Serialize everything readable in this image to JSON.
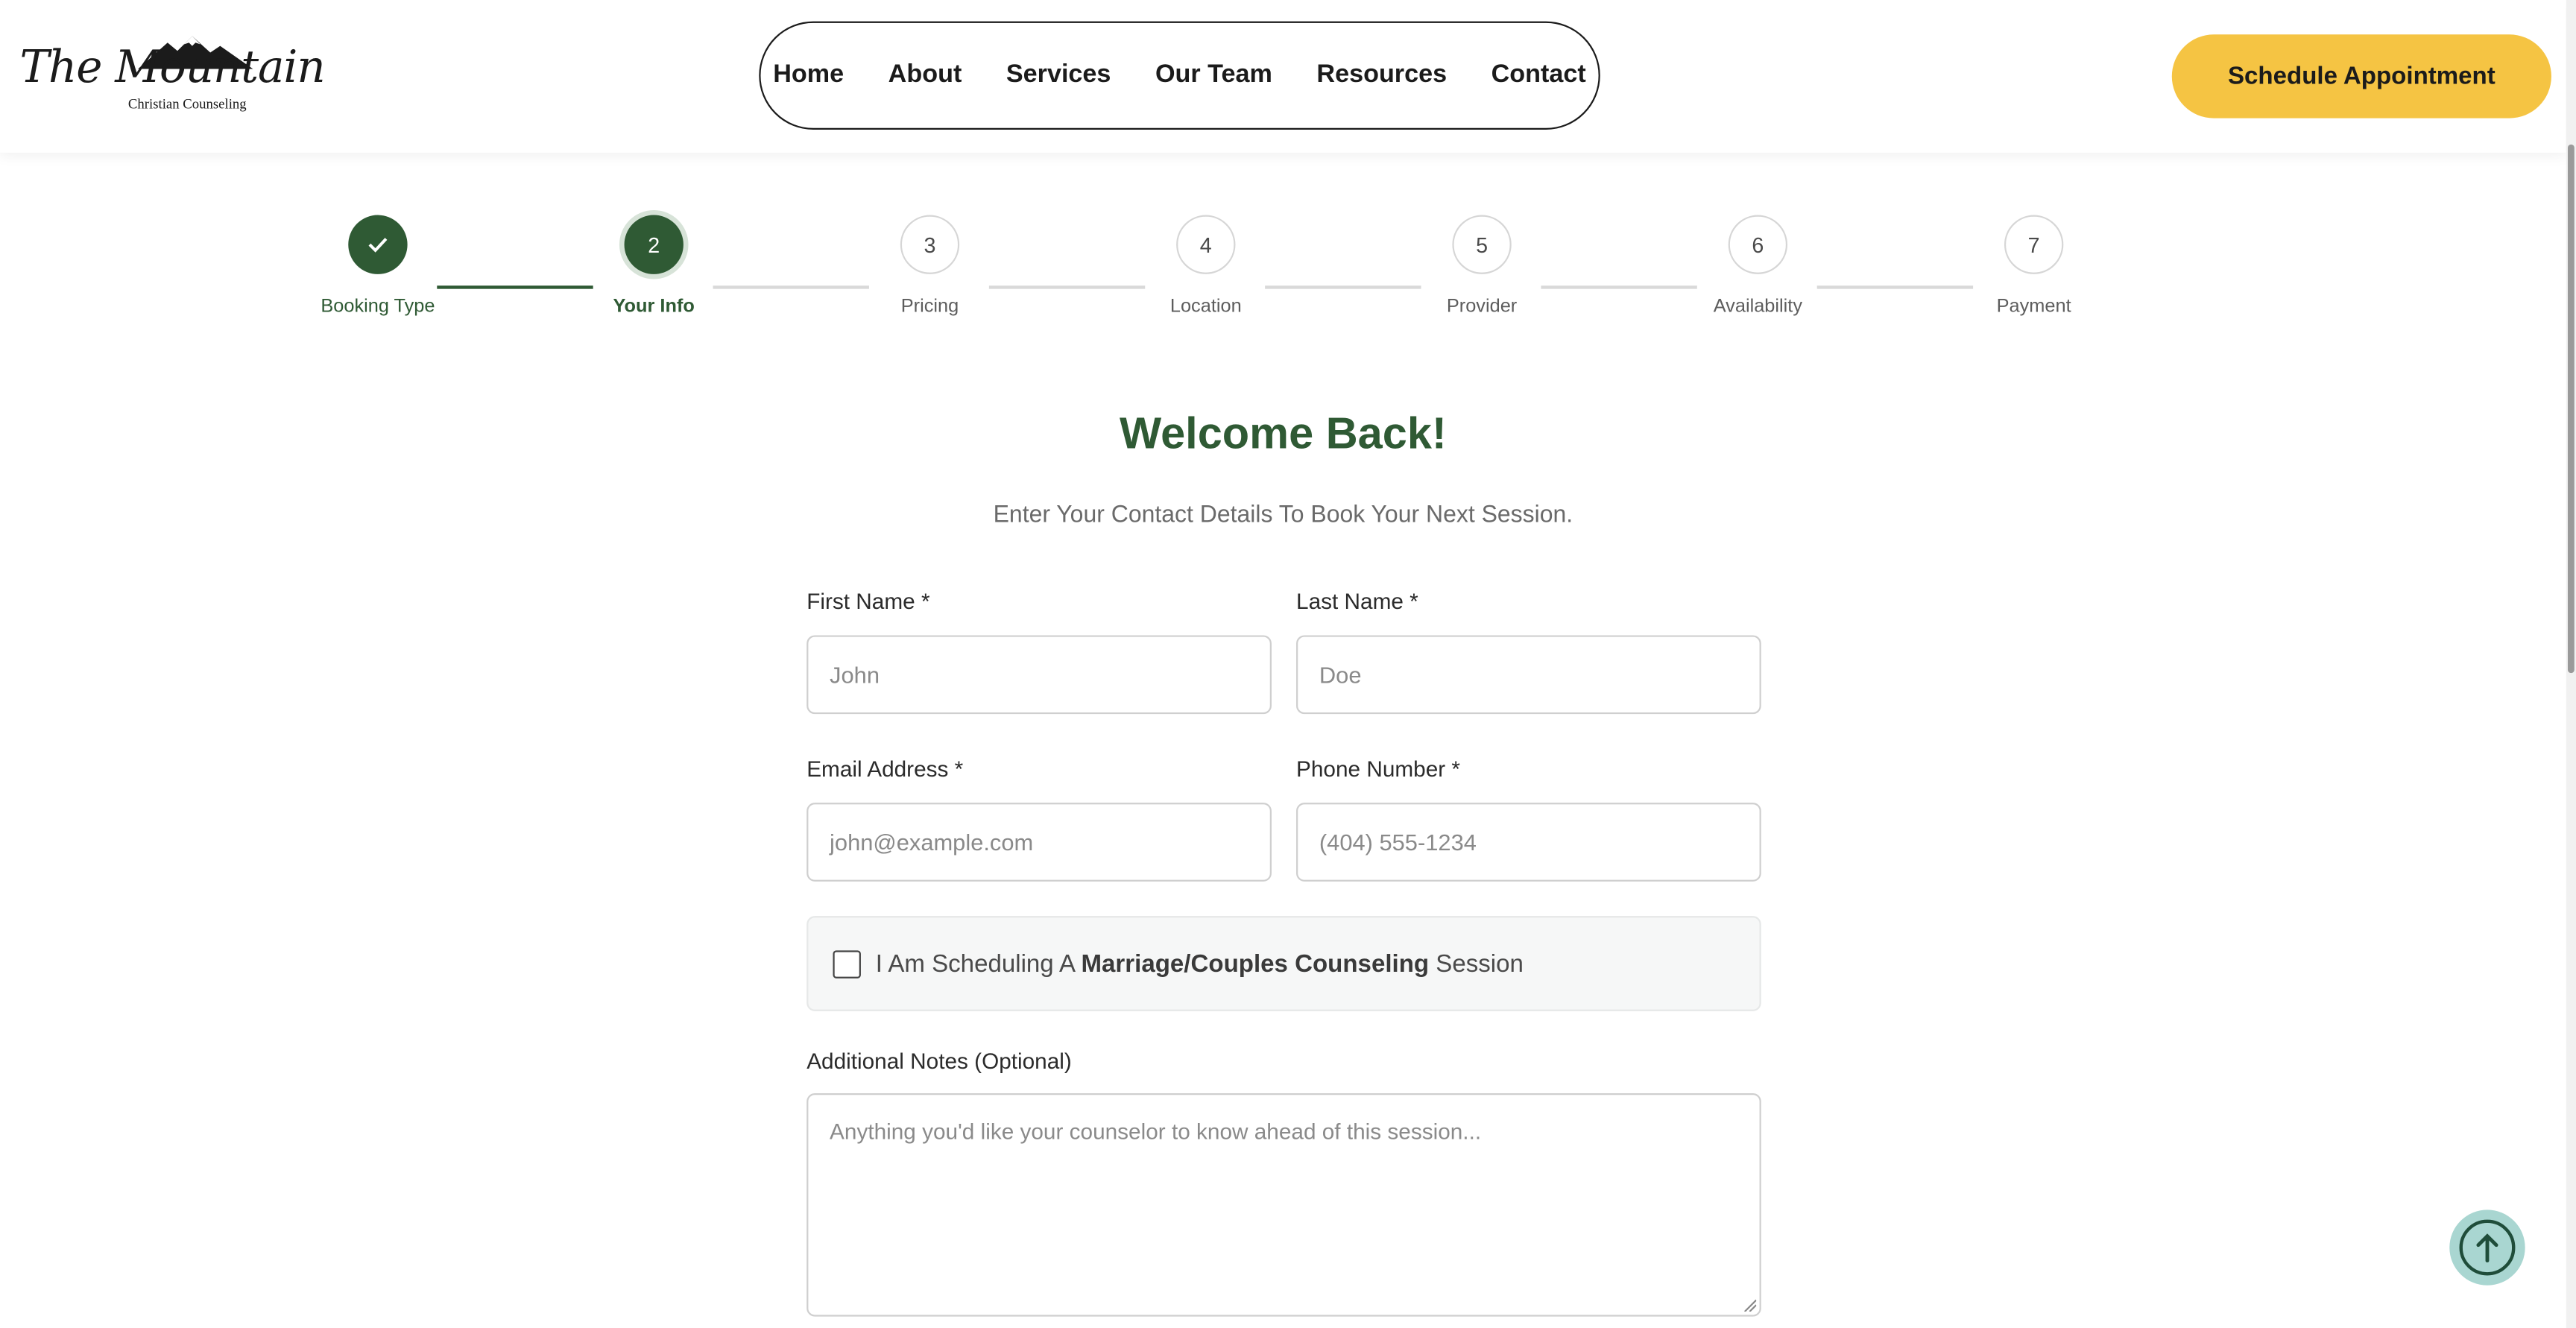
{
  "brand": {
    "logo_script": "The Mountain",
    "logo_sub": "Christian Counseling"
  },
  "nav": {
    "items": [
      "Home",
      "About",
      "Services",
      "Our Team",
      "Resources",
      "Contact"
    ],
    "cta": "Schedule Appointment"
  },
  "stepper": {
    "current_step": 2,
    "steps": [
      {
        "number": "✓",
        "label": "Booking Type",
        "state": "complete"
      },
      {
        "number": "2",
        "label": "Your Info",
        "state": "active"
      },
      {
        "number": "3",
        "label": "Pricing",
        "state": "pending"
      },
      {
        "number": "4",
        "label": "Location",
        "state": "pending"
      },
      {
        "number": "5",
        "label": "Provider",
        "state": "pending"
      },
      {
        "number": "6",
        "label": "Availability",
        "state": "pending"
      },
      {
        "number": "7",
        "label": "Payment",
        "state": "pending"
      }
    ]
  },
  "form": {
    "title": "Welcome Back!",
    "subtitle": "Enter Your Contact Details To Book Your Next Session.",
    "first_name": {
      "label": "First Name *",
      "placeholder": "John"
    },
    "last_name": {
      "label": "Last Name *",
      "placeholder": "Doe"
    },
    "email": {
      "label": "Email Address *",
      "placeholder": "john@example.com"
    },
    "phone": {
      "label": "Phone Number *",
      "placeholder": "(404) 555-1234"
    },
    "couples": {
      "prefix": "I Am Scheduling A ",
      "bold": "Marriage/Couples Counseling",
      "suffix": " Session",
      "checked": false
    },
    "notes": {
      "label": "Additional Notes (Optional)",
      "placeholder": "Anything you'd like your counselor to know ahead of this session..."
    }
  },
  "colors": {
    "brand_green": "#2f5a34",
    "cta_yellow": "#f5c443",
    "back_to_top": "#a9d6d1"
  },
  "icons": {
    "check": "check-icon",
    "back_to_top": "arrow-up-icon",
    "logo_mountain": "mountain-icon"
  }
}
